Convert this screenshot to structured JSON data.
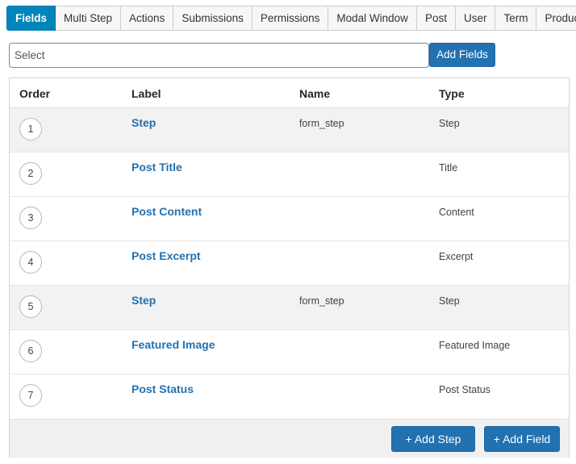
{
  "tabs": [
    {
      "label": "Fields",
      "active": true
    },
    {
      "label": "Multi Step",
      "active": false
    },
    {
      "label": "Actions",
      "active": false
    },
    {
      "label": "Submissions",
      "active": false
    },
    {
      "label": "Permissions",
      "active": false
    },
    {
      "label": "Modal Window",
      "active": false
    },
    {
      "label": "Post",
      "active": false
    },
    {
      "label": "User",
      "active": false
    },
    {
      "label": "Term",
      "active": false
    },
    {
      "label": "Product",
      "active": false
    }
  ],
  "field_select": {
    "value": "Select"
  },
  "add_fields_label": "Add Fields",
  "table": {
    "headers": {
      "order": "Order",
      "label": "Label",
      "name": "Name",
      "type": "Type"
    },
    "rows": [
      {
        "order": "1",
        "label": "Step",
        "name": "form_step",
        "type": "Step"
      },
      {
        "order": "2",
        "label": "Post Title",
        "name": "",
        "type": "Title"
      },
      {
        "order": "3",
        "label": "Post Content",
        "name": "",
        "type": "Content"
      },
      {
        "order": "4",
        "label": "Post Excerpt",
        "name": "",
        "type": "Excerpt"
      },
      {
        "order": "5",
        "label": "Step",
        "name": "form_step",
        "type": "Step"
      },
      {
        "order": "6",
        "label": "Featured Image",
        "name": "",
        "type": "Featured Image"
      },
      {
        "order": "7",
        "label": "Post Status",
        "name": "",
        "type": "Post Status"
      }
    ]
  },
  "footer": {
    "add_step_label": "+ Add Step",
    "add_field_label": "+ Add Field"
  },
  "colors": {
    "accent": "#2271b1",
    "active_tab": "#0085ba",
    "step_row_bg": "#f2f2f2"
  }
}
